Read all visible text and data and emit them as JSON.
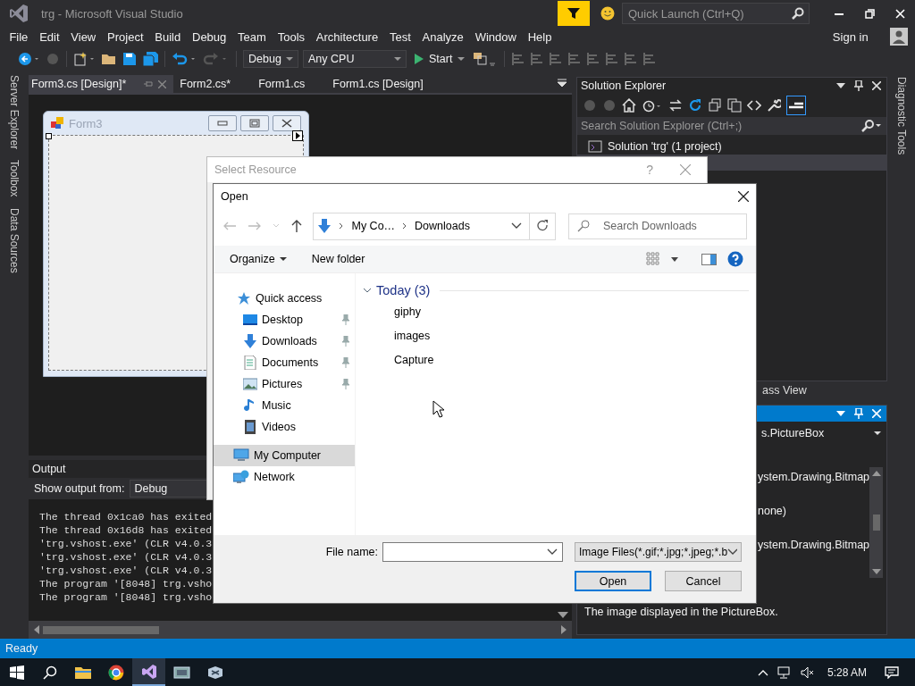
{
  "window": {
    "title": "trg - Microsoft Visual Studio"
  },
  "quick_launch": {
    "placeholder": "Quick Launch (Ctrl+Q)"
  },
  "menu": [
    "File",
    "Edit",
    "View",
    "Project",
    "Build",
    "Debug",
    "Team",
    "Tools",
    "Architecture",
    "Test",
    "Analyze",
    "Window",
    "Help"
  ],
  "account": {
    "label": "Sign in"
  },
  "toolbar": {
    "configuration": "Debug",
    "platform": "Any CPU",
    "start": "Start"
  },
  "side_tabs": [
    "Server Explorer",
    "Toolbox",
    "Data Sources"
  ],
  "doc_tabs": [
    {
      "label": "Form3.cs [Design]*",
      "selected": true
    },
    {
      "label": "Form2.cs*",
      "selected": false
    },
    {
      "label": "Form1.cs",
      "selected": false
    },
    {
      "label": "Form1.cs [Design]",
      "selected": false
    }
  ],
  "form": {
    "title": "Form3"
  },
  "output": {
    "title": "Output",
    "source_label": "Show output from:",
    "source": "Debug",
    "lines": [
      "The thread 0x1ca0 has exited",
      "The thread 0x16d8 has exited",
      "'trg.vshost.exe' (CLR v4.0.3",
      "'trg.vshost.exe' (CLR v4.0.3",
      "'trg.vshost.exe' (CLR v4.0.3",
      "The program '[8048] trg.vsho",
      "The program '[8048] trg.vsho"
    ]
  },
  "solution_explorer": {
    "title": "Solution Explorer",
    "search_placeholder": "Search Solution Explorer (Ctrl+;)",
    "items": [
      {
        "label": "Solution 'trg' (1 project)",
        "selected": false
      },
      {
        "selected": true
      }
    ]
  },
  "panel_tab": "ass View",
  "properties": {
    "object": "s.PictureBox",
    "rows": [
      "ystem.Drawing.Bitmap",
      "none)",
      "ystem.Drawing.Bitmap"
    ],
    "description": "The image displayed in the PictureBox."
  },
  "diagnostic_tab": "Diagnostic Tools",
  "status_bar": "Ready",
  "select_resource": {
    "title": "Select Resource",
    "help": "?"
  },
  "open_dialog": {
    "title": "Open",
    "breadcrumb": [
      "My Co…",
      "Downloads"
    ],
    "search_placeholder": "Search Downloads",
    "organize": "Organize",
    "new_folder": "New folder",
    "nav": [
      {
        "label": "Quick access",
        "kind": "star",
        "pinned": false,
        "selected": false,
        "children": [
          {
            "label": "Desktop",
            "kind": "desktop",
            "pinned": true,
            "selected": false
          },
          {
            "label": "Downloads",
            "kind": "download",
            "pinned": true,
            "selected": false
          },
          {
            "label": "Documents",
            "kind": "document",
            "pinned": true,
            "selected": false
          },
          {
            "label": "Pictures",
            "kind": "picture",
            "pinned": true,
            "selected": false
          },
          {
            "label": "Music",
            "kind": "music",
            "pinned": false,
            "selected": false
          },
          {
            "label": "Videos",
            "kind": "video",
            "pinned": false,
            "selected": false
          }
        ]
      },
      {
        "label": "My Computer",
        "kind": "computer",
        "pinned": false,
        "selected": true
      },
      {
        "label": "Network",
        "kind": "network",
        "pinned": false,
        "selected": false
      }
    ],
    "group": "Today (3)",
    "files": [
      "giphy",
      "images",
      "Capture"
    ],
    "file_name_label": "File name:",
    "file_type": "Image Files(*.gif;*.jpg;*.jpeg;*.b",
    "buttons": [
      "Open",
      "Cancel"
    ]
  },
  "taskbar": {
    "time": "5:28 AM"
  }
}
